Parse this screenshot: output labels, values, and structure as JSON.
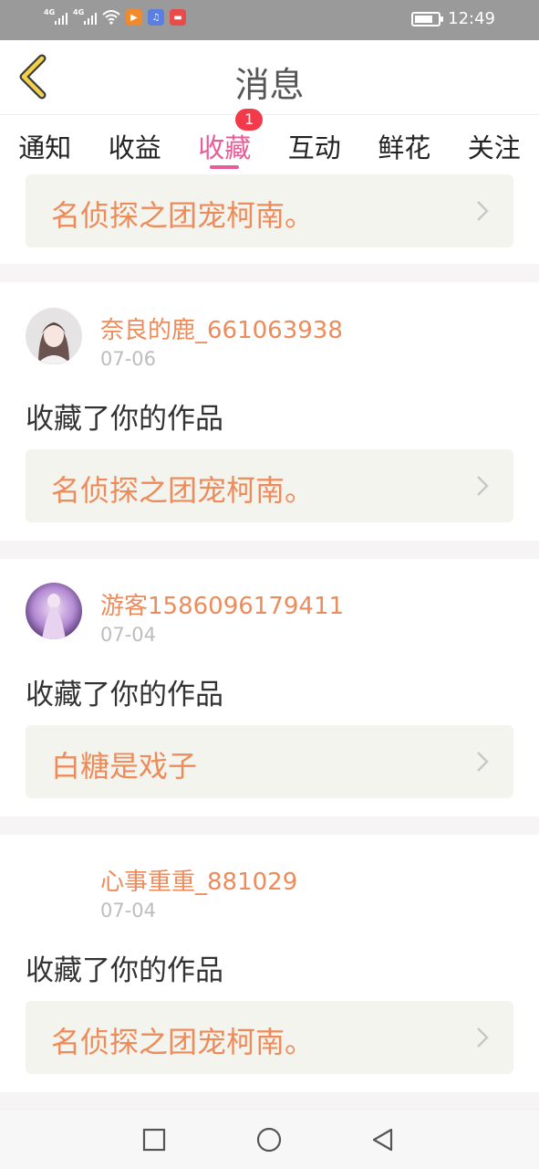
{
  "status_bar": {
    "net1": "4G",
    "net2": "4G",
    "time": "12:49",
    "battery_level": 0.8,
    "app_icons": [
      "video-app-icon",
      "music-app-icon",
      "shop-app-icon"
    ]
  },
  "header": {
    "title": "消息",
    "back_icon": "chevron-left-icon"
  },
  "tabs": [
    {
      "label": "通知"
    },
    {
      "label": "收益"
    },
    {
      "label": "收藏",
      "active": true,
      "badge": "1"
    },
    {
      "label": "互动"
    },
    {
      "label": "鲜花"
    },
    {
      "label": "关注"
    }
  ],
  "feed": {
    "partial_item": {
      "work_title": "名侦探之团宠柯南。"
    },
    "items": [
      {
        "username": "奈良的鹿_661063938",
        "date": "07-06",
        "action": "收藏了你的作品",
        "work_title": "名侦探之团宠柯南。"
      },
      {
        "username": "游客1586096179411",
        "date": "07-04",
        "action": "收藏了你的作品",
        "work_title": "白糖是戏子"
      },
      {
        "username": "心事重重_881029",
        "date": "07-04",
        "action": "收藏了你的作品",
        "work_title": "名侦探之团宠柯南。"
      }
    ]
  },
  "colors": {
    "accent": "#e85c98",
    "orange": "#ee8b5a",
    "badge": "#f23a4b"
  },
  "nav": {
    "icons": [
      "square-icon",
      "circle-icon",
      "triangle-back-icon"
    ]
  }
}
